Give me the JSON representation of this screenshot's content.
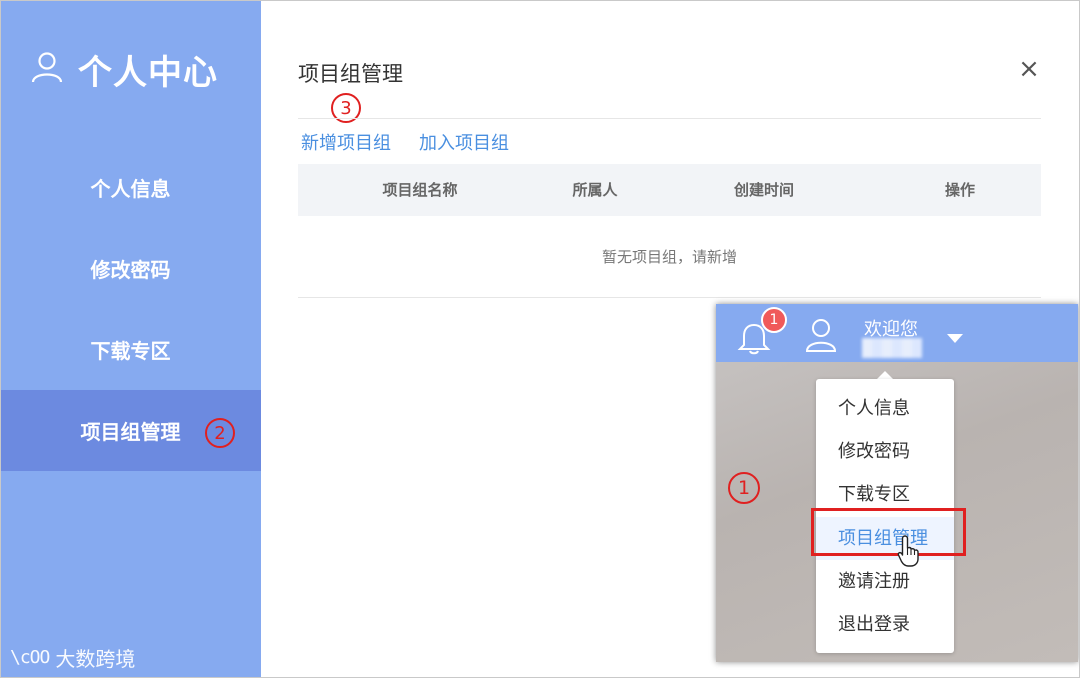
{
  "sidebar": {
    "title": "个人中心",
    "items": [
      {
        "label": "个人信息"
      },
      {
        "label": "修改密码"
      },
      {
        "label": "下载专区"
      },
      {
        "label": "项目组管理"
      }
    ],
    "active_index": 3,
    "watermark": {
      "logo": "\\cOO",
      "text": "大数跨境"
    }
  },
  "steps": {
    "one": "1",
    "two": "2",
    "three": "3"
  },
  "main": {
    "title": "项目组管理",
    "close": "×",
    "links": {
      "add": "新增项目组",
      "join": "加入项目组"
    },
    "columns": [
      "项目组名称",
      "所属人",
      "创建时间",
      "操作"
    ],
    "empty_text": "暂无项目组，请新增"
  },
  "inset": {
    "badge_count": "1",
    "welcome": "欢迎您",
    "menu": [
      "个人信息",
      "修改密码",
      "下载专区",
      "项目组管理",
      "邀请注册",
      "退出登录"
    ],
    "highlighted_index": 3
  },
  "colors": {
    "accent": "#86aaf0",
    "active": "#6c8ae0",
    "link": "#4a8fe0",
    "annotation": "#e02020",
    "badge": "#f05a5a"
  }
}
